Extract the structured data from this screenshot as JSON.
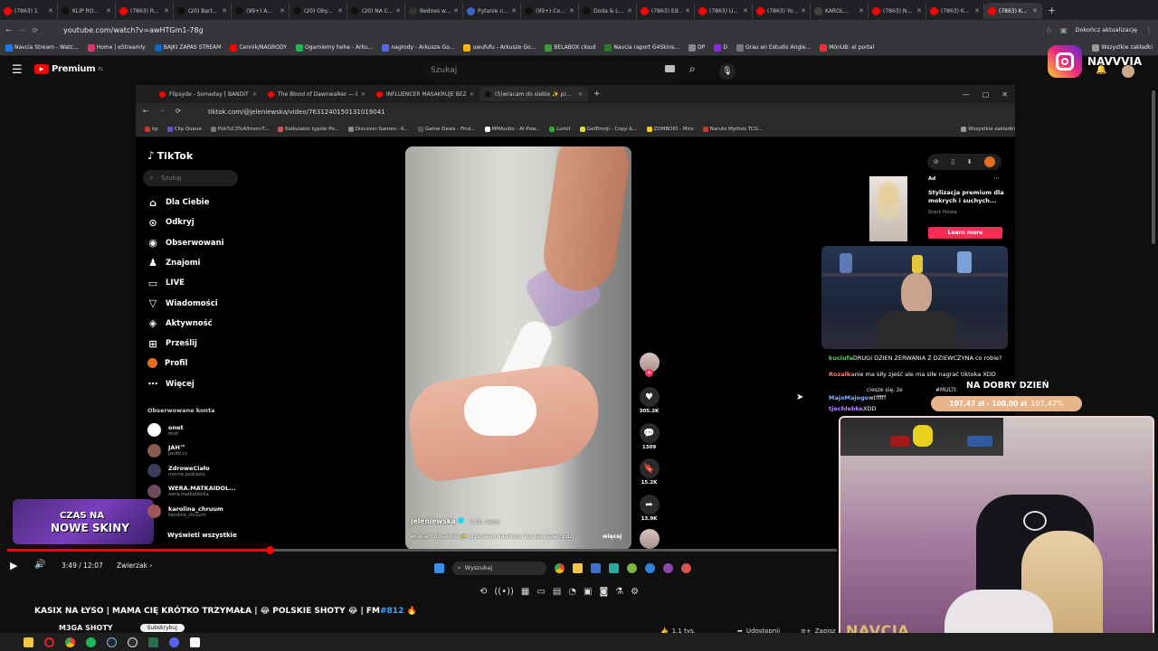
{
  "outer_browser": {
    "tabs": [
      "(7863) 1",
      "KLIP RO...",
      "(7863) R...",
      "(20) Bart...",
      "(99+) A...",
      "(20) Oby...",
      "(20) NA C...",
      "Bedoes w...",
      "Pytanie n...",
      "(99+) Co...",
      "Doda & L...",
      "(7863) Ed...",
      "(7863) U...",
      "(7863) Yo...",
      "KAROL...",
      "(7863) N...",
      "(7863) K...",
      "(7863) K..."
    ],
    "url": "youtube.com/watch?v=awHTGm1-78g",
    "update_label": "Dokończ aktualizację",
    "bookmarks": [
      "Navcia Stream - Watc...",
      "Home | eStreamly",
      "BAJKI ZAPAS STREAM",
      "Cennik/NAGRODY",
      "Ogarniemy hehe - Arku...",
      "nagrody - Arkusze Go...",
      "uwufufu - Arkusze Go...",
      "BELABOX cloud",
      "Navcia raport G4Skins...",
      "DP",
      "D",
      "Grau en Estudis Angle...",
      "MónUB: el portal",
      "Wszystkie zakładki"
    ]
  },
  "youtube": {
    "logo_text": "Premium",
    "logo_sup": "PL",
    "search_placeholder": "Szukaj",
    "video_title": "KASIX NA ŁYSO | MAMA CIĘ KRÓTKO TRZYMAŁA | 😂 POLSKIE SHOTY 😂 | FM",
    "video_tag": "#812",
    "channel": "M3GA SHOTY",
    "time": "3:49 / 12:07",
    "chapter": "Zwierzak",
    "progress_fraction": 0.316,
    "like_count": "1,1 tys.",
    "share_label": "Udostępnij",
    "save_label": "Zapisz",
    "subscribe_label": "Subskrybuj"
  },
  "inner_browser": {
    "tabs": [
      "Flipsyde - Someday [ BANDIT F",
      "The Blood of Dawnwalker — D",
      "INFLUENCER MASAKRUJE BEZP",
      "(5)wracam do siebie ✨ pr..."
    ],
    "url": "tiktok.com/@jeleniewska/video/7631240150131019041",
    "bookmarks": [
      "kp",
      "Clip Queue",
      "Pok%C3%A9mon-T...",
      "Kalkulator typów Po...",
      "Discover Games - K...",
      "Game Deals - Find...",
      "MMAudio - AI-Pow...",
      "Lurkit",
      "GetEmoji - Copy &...",
      "ZOMBOID - Miro",
      "Naruto Mythos TCG...",
      "Wszystkie zakładki"
    ]
  },
  "tiktok": {
    "logo": "TikTok",
    "search_placeholder": "Szukaj",
    "nav": [
      "Dla Ciebie",
      "Odkryj",
      "Obserwowani",
      "Znajomi",
      "LIVE",
      "Wiadomości",
      "Aktywność",
      "Prześlij",
      "Profil",
      "Więcej"
    ],
    "followed_header": "Obserwowane konta",
    "accounts": [
      {
        "name": "onet",
        "handle": "onet"
      },
      {
        "name": "JAH™",
        "handle": "jzedtt.cc"
      },
      {
        "name": "ZdroweCiało",
        "handle": "mocne.podcasty"
      },
      {
        "name": "WERA.MATKAIDOL...",
        "handle": "wera.matkaidolka"
      },
      {
        "name": "karolina_chruum",
        "handle": "karolina_chruum"
      }
    ],
    "see_all": "Wyświetl wszystkie",
    "video_author": "jeleniewska",
    "video_age": "· 1 dn. temu",
    "caption": "wracam do siebie ✨ przytulam każdego, kto też przechodzi",
    "more": "więcej",
    "likes": "305.2K",
    "comments": "1309",
    "saves": "15.2K",
    "shares": "13.9K",
    "ad_label": "Ad",
    "ad_title": "Stylizacja premium dla mokrych i suchych...",
    "ad_brand": "Shark Polska",
    "ad_button": "Learn more"
  },
  "overlays": {
    "instagram_handle": "NAVVVIA",
    "skins_line1": "CZAS NA",
    "skins_line2": "NOWE SKINY",
    "chat": [
      {
        "user": "kuciufa",
        "msg": "DRUGI DZIEN ZERWANIA Z DZIEWCZYNA co robie?",
        "color": "#5fd35f"
      },
      {
        "user": "Rozalka",
        "msg": "nie ma siły zjeść ale ma siłe nagrać tiktoka XDD",
        "color": "#ff7a7a"
      },
      {
        "user": "MajoMajogo",
        "msg": "wtfffff",
        "color": "#8ab4ff"
      },
      {
        "user": "tjechlebke",
        "msg": "XDD",
        "color": "#b58aff"
      }
    ],
    "chat_side": "ciesze się, że",
    "multi_tag": "#MULTI:",
    "goal_title": "NA DOBRY DZIEŃ",
    "goal_text": "107,47 zł - 100,00 zł",
    "goal_pct": "107,47%",
    "cam_watermark": "NAVCIA"
  },
  "windows_taskbar": {
    "search": "Wyszukaj"
  },
  "colors": {
    "yt_red": "#ff0000",
    "tiktok_pink": "#fe2c55",
    "goal": "#e7b48a"
  }
}
